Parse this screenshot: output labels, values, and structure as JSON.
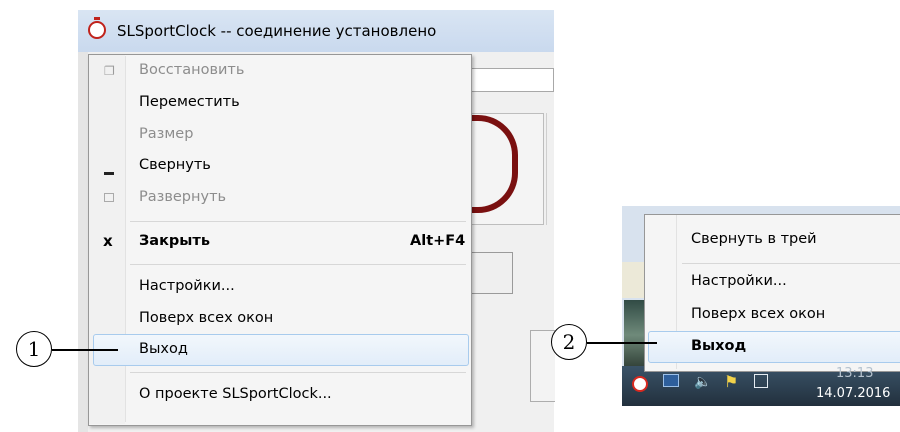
{
  "window": {
    "title": "SLSportClock -- соединение установлено",
    "icon": "stopwatch-icon"
  },
  "system_menu": {
    "items": [
      {
        "label": "Восстановить",
        "icon": "restore-icon",
        "enabled": false
      },
      {
        "label": "Переместить",
        "enabled": true
      },
      {
        "label": "Размер",
        "enabled": false
      },
      {
        "label": "Свернуть",
        "icon": "minimize-icon",
        "enabled": true
      },
      {
        "label": "Развернуть",
        "icon": "maximize-icon",
        "enabled": false
      },
      {
        "label": "Закрыть",
        "icon": "close-icon",
        "shortcut": "Alt+F4",
        "enabled": true,
        "bold": true
      },
      {
        "label": "Настройки...",
        "enabled": true
      },
      {
        "label": "Поверх всех окон",
        "enabled": true
      },
      {
        "label": "Выход",
        "enabled": true,
        "highlighted": true
      },
      {
        "label": "О проекте SLSportClock...",
        "enabled": true
      }
    ]
  },
  "tray_menu": {
    "items": [
      {
        "label": "Свернуть в трей"
      },
      {
        "label": "Настройки..."
      },
      {
        "label": "Поверх всех окон"
      },
      {
        "label": "Выход",
        "bold": true,
        "highlighted": true
      }
    ]
  },
  "taskbar": {
    "time": "13:13",
    "date": "14.07.2016",
    "icons": [
      "stopwatch-icon",
      "monitor-icon",
      "speaker-icon",
      "flag-warning-icon",
      "network-icon"
    ]
  },
  "callouts": {
    "one": "1",
    "two": "2"
  },
  "colors": {
    "highlight_border": "#a8cbed",
    "clock_red": "#c0231c",
    "disabled_text": "#8d8d8d"
  }
}
